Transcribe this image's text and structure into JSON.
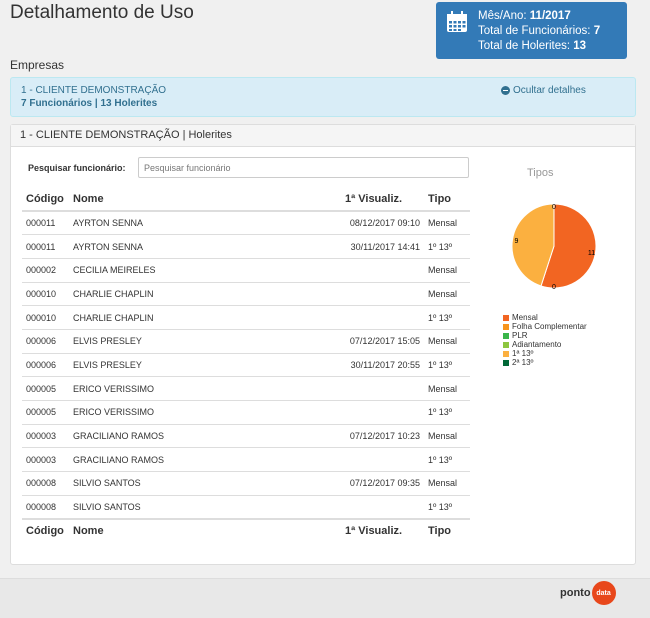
{
  "page": {
    "title": "Detalhamento de Uso"
  },
  "summary": {
    "month_label": "Mês/Ano:",
    "month_value": "11/2017",
    "employees_label": "Total de Funcionários:",
    "employees_value": "7",
    "payslips_label": "Total de Holerites:",
    "payslips_value": "13"
  },
  "section": {
    "label": "Empresas"
  },
  "company": {
    "name": "1 - CLIENTE DEMONSTRAÇÃO",
    "counts": "7 Funcionários | 13 Holerites",
    "toggle_label": "Ocultar detalhes"
  },
  "panel": {
    "heading": "1 - CLIENTE DEMONSTRAÇÃO | Holerites"
  },
  "search": {
    "label": "Pesquisar funcionário:",
    "placeholder": "Pesquisar funcionário"
  },
  "table": {
    "headers": {
      "code": "Código",
      "name": "Nome",
      "first_view": "1ª Visualiz.",
      "type": "Tipo"
    },
    "rows": [
      {
        "code": "000011",
        "name": "AYRTON SENNA",
        "first_view": "08/12/2017 09:10",
        "type": "Mensal"
      },
      {
        "code": "000011",
        "name": "AYRTON SENNA",
        "first_view": "30/11/2017 14:41",
        "type": "1º 13º"
      },
      {
        "code": "000002",
        "name": "CECILIA MEIRELES",
        "first_view": "",
        "type": "Mensal"
      },
      {
        "code": "000010",
        "name": "CHARLIE CHAPLIN",
        "first_view": "",
        "type": "Mensal"
      },
      {
        "code": "000010",
        "name": "CHARLIE CHAPLIN",
        "first_view": "",
        "type": "1º 13º"
      },
      {
        "code": "000006",
        "name": "ELVIS PRESLEY",
        "first_view": "07/12/2017 15:05",
        "type": "Mensal"
      },
      {
        "code": "000006",
        "name": "ELVIS PRESLEY",
        "first_view": "30/11/2017 20:55",
        "type": "1º 13º"
      },
      {
        "code": "000005",
        "name": "ERICO VERISSIMO",
        "first_view": "",
        "type": "Mensal"
      },
      {
        "code": "000005",
        "name": "ERICO VERISSIMO",
        "first_view": "",
        "type": "1º 13º"
      },
      {
        "code": "000003",
        "name": "GRACILIANO RAMOS",
        "first_view": "07/12/2017 10:23",
        "type": "Mensal"
      },
      {
        "code": "000003",
        "name": "GRACILIANO RAMOS",
        "first_view": "",
        "type": "1º 13º"
      },
      {
        "code": "000008",
        "name": "SILVIO SANTOS",
        "first_view": "07/12/2017 09:35",
        "type": "Mensal"
      },
      {
        "code": "000008",
        "name": "SILVIO SANTOS",
        "first_view": "",
        "type": "1º 13º"
      }
    ]
  },
  "chart_data": {
    "type": "pie",
    "title": "Tipos",
    "categories": [
      "Mensal",
      "Folha Complementar",
      "PLR",
      "Adiantamento",
      "1ª 13º",
      "2ª 13º"
    ],
    "values": [
      11,
      0,
      0,
      0,
      9,
      0
    ],
    "colors": [
      "#f26522",
      "#f7941d",
      "#39b54a",
      "#8dc63f",
      "#fbb040",
      "#006837"
    ],
    "legend_position": "bottom"
  },
  "footer": {
    "logo_text": "ponto",
    "logo_badge": "data"
  },
  "colors": {
    "accent": "#337ab7",
    "info_bg": "#d9edf7",
    "info_text": "#31708f"
  }
}
